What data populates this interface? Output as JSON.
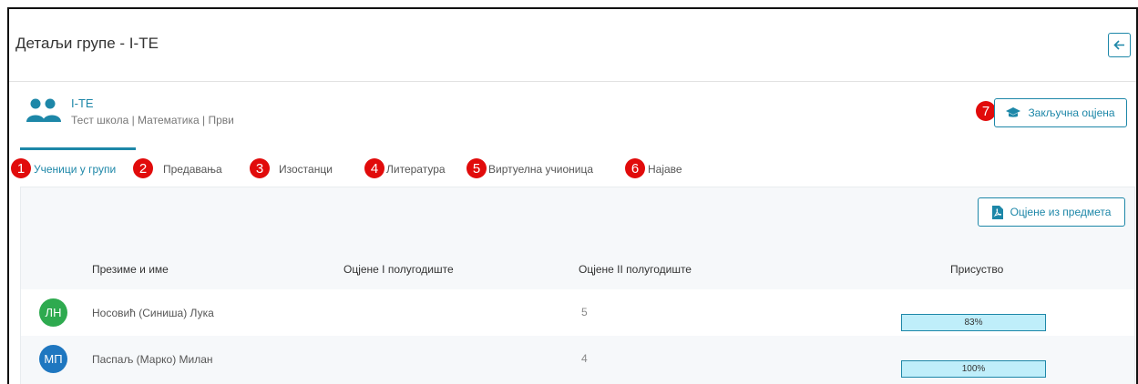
{
  "header": {
    "title": "Детаљи групе - I-TE",
    "back_icon": "arrow-left-icon"
  },
  "group": {
    "name": "I-TE",
    "subtitle": "Тест школа | Математика | Први",
    "icon": "users-icon"
  },
  "final_grade_button": {
    "label": "Закључна оцјена",
    "icon": "graduation-cap-icon"
  },
  "badges": [
    "1",
    "2",
    "3",
    "4",
    "5",
    "6",
    "7"
  ],
  "tabs": [
    {
      "label": "Ученици у групи",
      "active": true
    },
    {
      "label": "Предавања",
      "active": false
    },
    {
      "label": "Изостанци",
      "active": false
    },
    {
      "label": "Литература",
      "active": false
    },
    {
      "label": "Виртуелна учионица",
      "active": false
    },
    {
      "label": "Најаве",
      "active": false
    }
  ],
  "grades_button": {
    "label": "Оцјене из предмета",
    "icon": "pdf-file-icon"
  },
  "table": {
    "headers": [
      "Презиме и име",
      "Оцјене I полугодиште",
      "Оцјене II полугодиште",
      "Присуство"
    ],
    "rows": [
      {
        "initials": "ЛН",
        "avatar_color": "#2eaa4f",
        "name": "Носовић (Синиша) Лука",
        "grades1": "",
        "grades2": "5",
        "attendance": 0.83,
        "attendance_label": "83%"
      },
      {
        "initials": "МП",
        "avatar_color": "#1f77c0",
        "name": "Паспаљ (Марко) Милан",
        "grades1": "",
        "grades2": "4",
        "attendance": 1.0,
        "attendance_label": "100%"
      }
    ]
  },
  "colors": {
    "accent": "#1d87a8",
    "badge": "#e10b0b",
    "progress_fill": "#bfeefa"
  }
}
